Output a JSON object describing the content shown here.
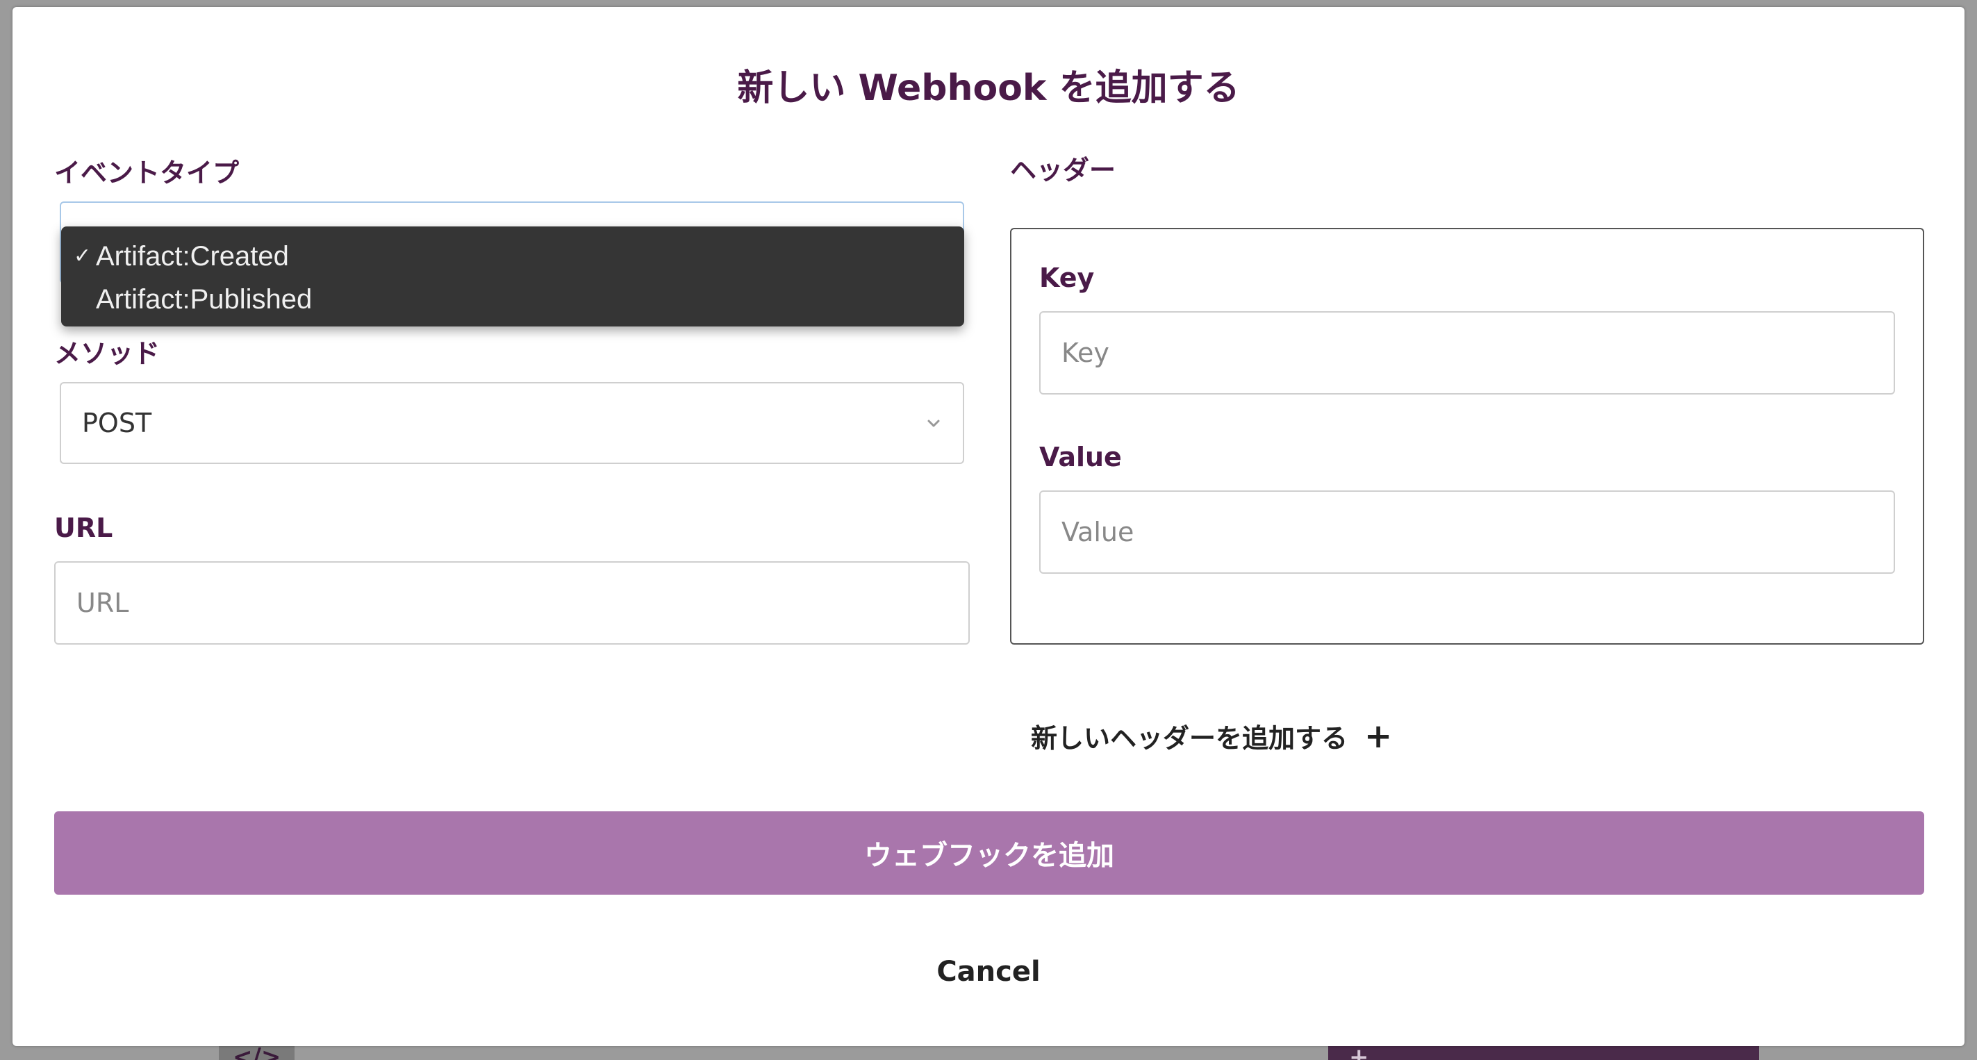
{
  "modal": {
    "title": "新しい Webhook を追加する"
  },
  "form": {
    "event_type": {
      "label": "イベントタイプ",
      "options": [
        {
          "label": "Artifact:Created",
          "selected": true
        },
        {
          "label": "Artifact:Published",
          "selected": false
        }
      ]
    },
    "method": {
      "label": "メソッド",
      "value": "POST"
    },
    "url": {
      "label": "URL",
      "placeholder": "URL"
    }
  },
  "headers": {
    "label": "ヘッダー",
    "key_label": "Key",
    "key_placeholder": "Key",
    "value_label": "Value",
    "value_placeholder": "Value",
    "add_label": "新しいヘッダーを追加する",
    "add_icon": "+"
  },
  "actions": {
    "submit_label": "ウェブフックを追加",
    "cancel_label": "Cancel"
  },
  "icons": {
    "check": "✓",
    "chevron": "chevron-down-icon"
  },
  "colors": {
    "title": "#4a1a48",
    "submit_bg": "#a976ac",
    "dropdown_bg": "#353535"
  }
}
